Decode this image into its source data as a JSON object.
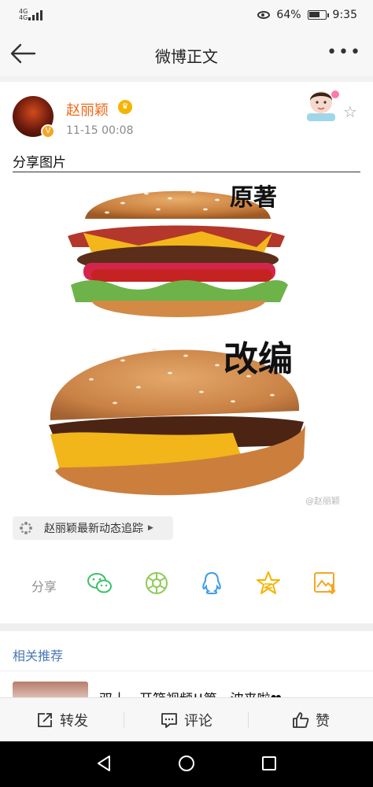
{
  "status": {
    "signal_small": "4G\n4G",
    "battery_pct": "64%",
    "time": "9:35"
  },
  "nav": {
    "title": "微博正文"
  },
  "post": {
    "username": "赵丽颖",
    "time": "11-15 00:08",
    "text": "分享图片",
    "image_labels": {
      "top": "原著",
      "bottom": "改编"
    },
    "watermark": "@赵丽颖"
  },
  "topic": {
    "label": "赵丽颖最新动态追踪"
  },
  "share": {
    "label": "分享"
  },
  "related": {
    "heading": "相关推荐",
    "item_title": "双十一开箱视频!!第一波来啦❤"
  },
  "actions": {
    "repost": "转发",
    "comment": "评论",
    "like": "赞"
  },
  "colors": {
    "accent_orange": "#f06a1a",
    "link_blue": "#4a78b5",
    "wechat": "#3cc06a",
    "moments": "#8fcb56",
    "qq": "#3d9ee6",
    "qzone": "#f5b400",
    "album": "#f5a623"
  }
}
